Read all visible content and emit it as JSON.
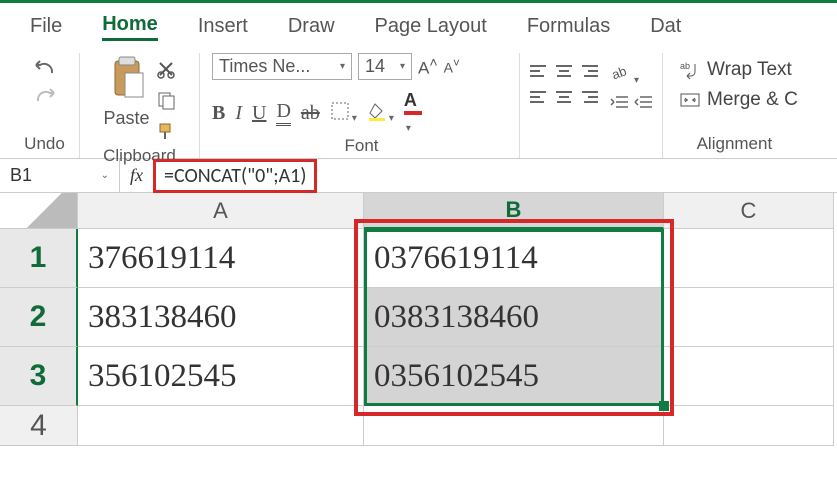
{
  "tabs": {
    "file": "File",
    "home": "Home",
    "insert": "Insert",
    "draw": "Draw",
    "page_layout": "Page Layout",
    "formulas": "Formulas",
    "data": "Dat"
  },
  "ribbon": {
    "undo_label": "Undo",
    "paste_label": "Paste",
    "clipboard_label": "Clipboard",
    "font_name": "Times Ne...",
    "font_size": "14",
    "font_label": "Font",
    "alignment_label": "Alignment",
    "wrap_text": "Wrap Text",
    "merge_center": "Merge & C"
  },
  "formula_bar": {
    "cell_ref": "B1",
    "fx": "fx",
    "formula": "=CONCAT(\"0\";A1)"
  },
  "columns": {
    "a": "A",
    "b": "B",
    "c": "C"
  },
  "rows": {
    "r1": "1",
    "r2": "2",
    "r3": "3",
    "r4": "4"
  },
  "cells": {
    "a1": "376619114",
    "a2": "383138460",
    "a3": "356102545",
    "b1": "0376619114",
    "b2": "0383138460",
    "b3": "0356102545"
  },
  "chart_data": {
    "type": "table",
    "columns": [
      "A",
      "B"
    ],
    "rows": [
      [
        "376619114",
        "0376619114"
      ],
      [
        "383138460",
        "0383138460"
      ],
      [
        "356102545",
        "0356102545"
      ]
    ],
    "active_formula": "=CONCAT(\"0\";A1)",
    "active_cell": "B1",
    "selection": "B1:B3"
  }
}
